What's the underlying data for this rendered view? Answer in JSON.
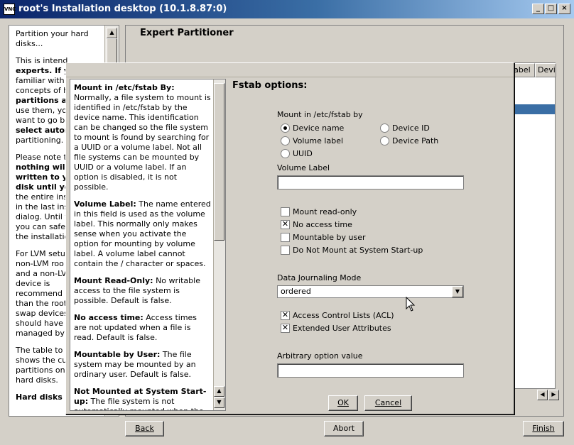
{
  "window": {
    "icon": "VNC",
    "title": "root's Installation desktop (10.1.8.87:0)",
    "minimize": "_",
    "maximize": "□",
    "close": "×"
  },
  "bg_help": {
    "p1": [
      "Partition your hard",
      "disks..."
    ],
    "p2": [
      "This is intend",
      "experts. If yo",
      "familiar with",
      "concepts of h",
      "partitions ar",
      "use them, yo",
      "want to go ba",
      "select autom",
      "partitioning."
    ],
    "p3": [
      "Please note t",
      "nothing will",
      "written to yo",
      "disk until yo",
      "the entire ins",
      "in the last ins",
      "dialog. Until t",
      "you can safe",
      "the installatio"
    ],
    "p4": [
      "For LVM setu",
      "non-LVM roo",
      "and a non-LV",
      "device is",
      "recommend",
      "than the root",
      "swap devices",
      "should have",
      "managed by"
    ],
    "p5": [
      "The table to t",
      "shows the cu",
      "partitions on",
      "hard disks."
    ],
    "p6": [
      "Hard disks a"
    ]
  },
  "partitioner": {
    "title": "Expert Partitioner",
    "col_label": "Label",
    "col_device": "Devi"
  },
  "main_buttons": {
    "back": "Back",
    "abort": "Abort",
    "finish": "Finish"
  },
  "dialog_help": {
    "s1_title": "Mount in /etc/fstab By:",
    "s1_body": "Normally, a file system to mount is identified in /etc/fstab by the device name. This identification can be changed so the file system to mount is found by searching for a UUID or a volume label. Not all file systems can be mounted by UUID or a volume label. If an option is disabled, it is not possible.",
    "s2_title": "Volume Label:",
    "s2_body": "The name entered in this field is used as the volume label. This normally only makes sense when you activate the option for mounting by volume label. A volume label cannot contain the / character or spaces.",
    "s3_title": "Mount Read-Only:",
    "s3_body": "No writable access to the file system is possible. Default is false.",
    "s4_title": "No access time:",
    "s4_body": "Access times are not updated when a file is read. Default is false.",
    "s5_title": "Mountable by User:",
    "s5_body": "The file system may be mounted by an ordinary user. Default is false.",
    "s6_title": "Not Mounted at System Start-up:",
    "s6_body": "The file system is not automatically mounted when the system starts. An"
  },
  "form": {
    "title": "Fstab options:",
    "mount_by_label": "Mount in /etc/fstab by",
    "radios": {
      "device_name": "Device name",
      "volume_label": "Volume label",
      "uuid": "UUID",
      "device_id": "Device ID",
      "device_path": "Device Path",
      "selected": "Device name"
    },
    "volume_label_field": "Volume Label",
    "volume_label_value": "",
    "checks": {
      "read_only": "Mount read-only",
      "noatime": "No access time",
      "user": "Mountable by user",
      "noauto": "Do Not Mount at System Start-up",
      "acl": "Access Control Lists (ACL)",
      "xattr": "Extended User Attributes"
    },
    "journal_label": "Data Journaling Mode",
    "journal_value": "ordered",
    "arbitrary_label": "Arbitrary option value",
    "arbitrary_value": "",
    "ok": "OK",
    "cancel": "Cancel"
  },
  "colors": {
    "titlebar": "#0a246a",
    "selection": "#3a6ea5",
    "face": "#d4d0c8"
  }
}
